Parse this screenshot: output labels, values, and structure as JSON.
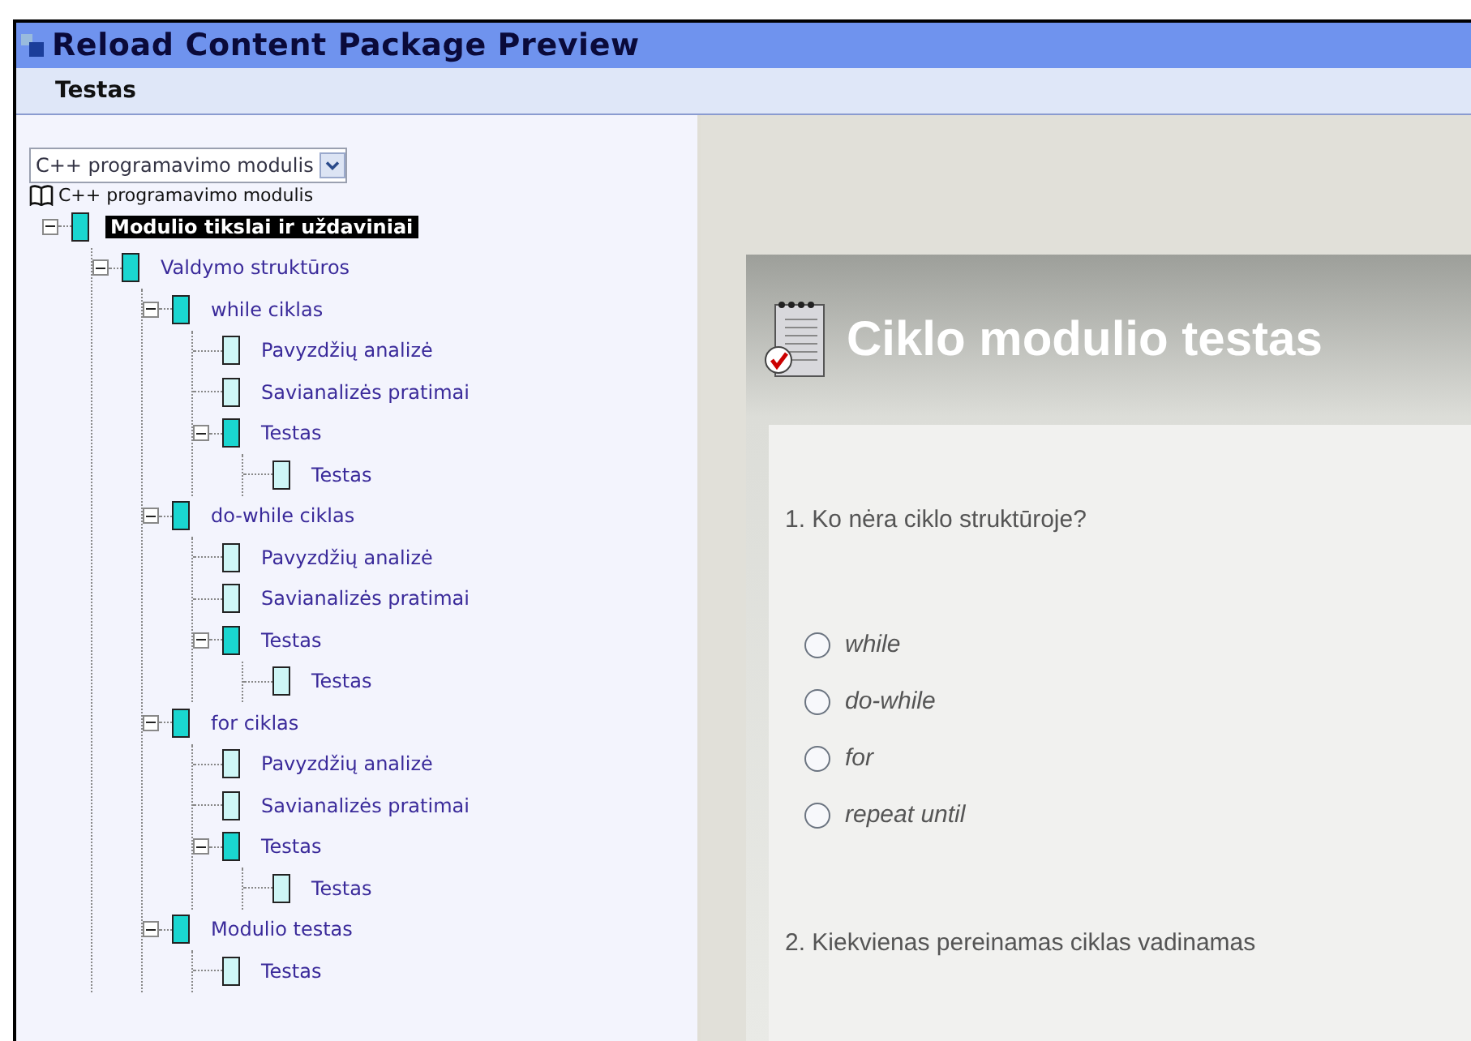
{
  "window": {
    "title": "Reload Content Package Preview"
  },
  "subtitle": "Testas",
  "sidebar": {
    "dropdown": {
      "value": "C++ programavimo modulis"
    },
    "tree": {
      "root": "C++ programavimo modulis",
      "children": [
        {
          "label": "Modulio tikslai ir uždaviniai",
          "kind": "folder",
          "expanded": true,
          "selected": true,
          "children": [
            {
              "label": "Valdymo struktūros",
              "kind": "folder",
              "expanded": true,
              "selected": false,
              "children": [
                {
                  "label": "while ciklas",
                  "kind": "folder",
                  "expanded": true,
                  "selected": false,
                  "children": [
                    {
                      "label": "Pavyzdžių analizė",
                      "kind": "page",
                      "selected": false
                    },
                    {
                      "label": "Savianalizės pratimai",
                      "kind": "page",
                      "selected": false
                    },
                    {
                      "label": "Testas",
                      "kind": "folder",
                      "expanded": true,
                      "selected": false,
                      "children": [
                        {
                          "label": "Testas",
                          "kind": "page",
                          "selected": false
                        }
                      ]
                    }
                  ]
                },
                {
                  "label": "do-while ciklas",
                  "kind": "folder",
                  "expanded": true,
                  "selected": false,
                  "children": [
                    {
                      "label": "Pavyzdžių analizė",
                      "kind": "page",
                      "selected": false
                    },
                    {
                      "label": "Savianalizės pratimai",
                      "kind": "page",
                      "selected": false
                    },
                    {
                      "label": "Testas",
                      "kind": "folder",
                      "expanded": true,
                      "selected": false,
                      "children": [
                        {
                          "label": "Testas",
                          "kind": "page",
                          "selected": false
                        }
                      ]
                    }
                  ]
                },
                {
                  "label": "for ciklas",
                  "kind": "folder",
                  "expanded": true,
                  "selected": false,
                  "children": [
                    {
                      "label": "Pavyzdžių analizė",
                      "kind": "page",
                      "selected": false
                    },
                    {
                      "label": "Savianalizės pratimai",
                      "kind": "page",
                      "selected": false
                    },
                    {
                      "label": "Testas",
                      "kind": "folder",
                      "expanded": true,
                      "selected": false,
                      "children": [
                        {
                          "label": "Testas",
                          "kind": "page",
                          "selected": false
                        }
                      ]
                    }
                  ]
                },
                {
                  "label": "Modulio testas",
                  "kind": "folder",
                  "expanded": true,
                  "selected": false,
                  "children": [
                    {
                      "label": "Testas",
                      "kind": "page",
                      "selected": false
                    }
                  ]
                }
              ]
            }
          ]
        }
      ]
    }
  },
  "content": {
    "title": "Ciklo modulio testas",
    "questions": [
      {
        "text": "1. Ko nėra ciklo struktūroje?",
        "options": [
          {
            "label": "while",
            "selected": false
          },
          {
            "label": "do-while",
            "selected": false
          },
          {
            "label": "for",
            "selected": false
          },
          {
            "label": "repeat until",
            "selected": false
          }
        ]
      },
      {
        "text": "2. Kiekvienas pereinamas ciklas vadinamas"
      }
    ]
  }
}
